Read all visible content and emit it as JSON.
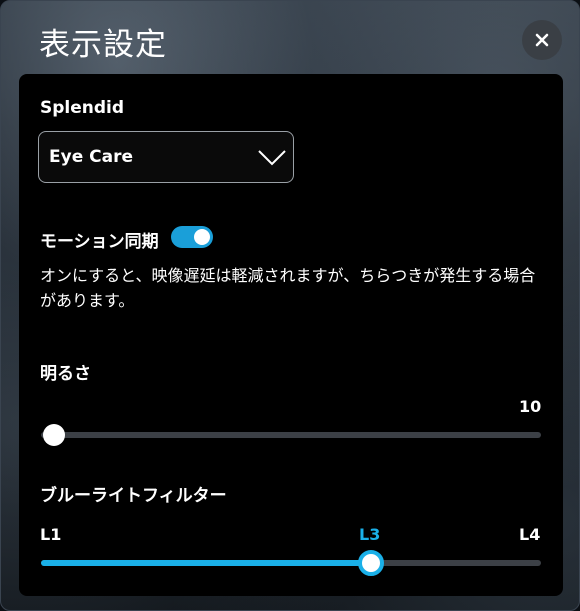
{
  "window": {
    "title": "表示設定"
  },
  "close": {
    "icon": "close-icon"
  },
  "splendid": {
    "label": "Splendid",
    "selected": "Eye Care",
    "icon": "chevron-down-icon"
  },
  "motion_sync": {
    "label": "モーション同期",
    "enabled": true,
    "description": "オンにすると、映像遅延は軽減されますが、ちらつきが発生する場合があります。"
  },
  "brightness": {
    "label": "明るさ",
    "value": "10",
    "level": 0.0
  },
  "blue_light": {
    "label": "ブルーライトフィルター",
    "levels": [
      "L1",
      "L3",
      "L4"
    ],
    "selected": "L3",
    "fill_fraction": 0.66
  },
  "colors": {
    "accent": "#1ab0e8",
    "toggle_on": "#1a9fd9",
    "track": "#3c4046",
    "panel": "#000000"
  }
}
